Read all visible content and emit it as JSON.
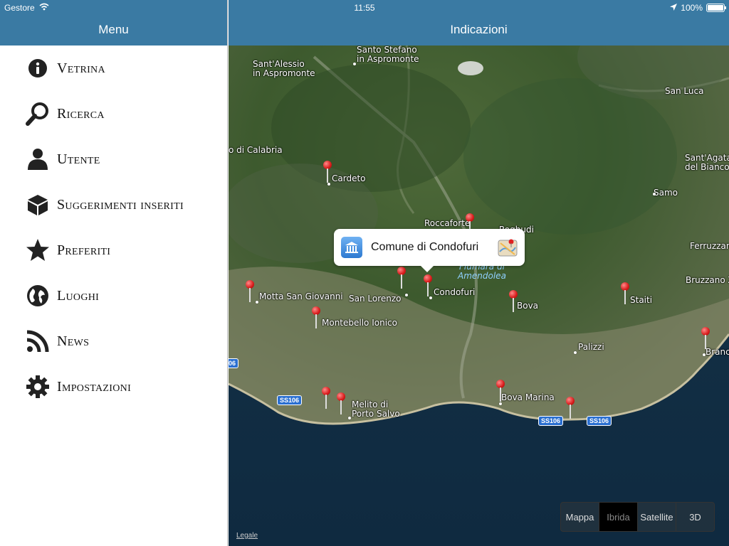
{
  "status": {
    "carrier": "Gestore",
    "time": "11:55",
    "battery": "100%"
  },
  "sidebar": {
    "title": "Menu",
    "items": [
      {
        "label": "Vetrina",
        "icon": "info-icon"
      },
      {
        "label": "Ricerca",
        "icon": "search-icon"
      },
      {
        "label": "Utente",
        "icon": "user-icon"
      },
      {
        "label": "Suggerimenti inseriti",
        "icon": "box-icon"
      },
      {
        "label": "Preferiti",
        "icon": "star-icon"
      },
      {
        "label": "Luoghi",
        "icon": "globe-icon"
      },
      {
        "label": "News",
        "icon": "rss-icon"
      },
      {
        "label": "Impostazioni",
        "icon": "gear-icon"
      }
    ]
  },
  "map": {
    "title": "Indicazioni",
    "callout": {
      "text": "Comune di Condofuri"
    },
    "places": {
      "santo_stefano": "Santo Stefano\nin Aspromonte",
      "sant_alessio": "Sant'Alessio\nin Aspromonte",
      "san_luca": "San Luca",
      "reggio": "o di Calabria",
      "sant_agata": "Sant'Agata\ndel Bianco",
      "cardeto": "Cardeto",
      "samo": "Samo",
      "roccaforte": "Roccaforte",
      "roghudi": "Roghudi",
      "ferruzzano": "Ferruzzan",
      "motta": "Motta San Giovanni",
      "san_lorenzo": "San Lorenzo",
      "condofuri": "Condofuri",
      "bova": "Bova",
      "staiti": "Staiti",
      "bruzzano": "Bruzzano Ze",
      "montebello": "Montebello Ionico",
      "palizzi": "Palizzi",
      "brancaleone": "Branc",
      "bova_marina": "Bova Marina",
      "melito": "Melito di\nPorto Salvo"
    },
    "water": "Fiumara di\nAmendolea",
    "roads": {
      "ss106_a": "SS106",
      "ss106_b": "SS106",
      "ss106_c": "SS106",
      "edge": "06"
    },
    "map_types": [
      "Mappa",
      "Ibrida",
      "Satellite",
      "3D"
    ],
    "selected_type": "Ibrida",
    "legal": "Legale"
  }
}
